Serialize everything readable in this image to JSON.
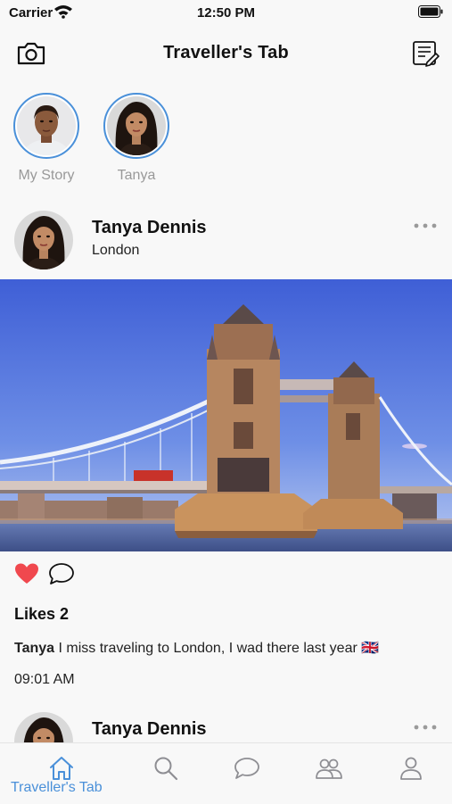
{
  "status_bar": {
    "carrier": "Carrier",
    "time": "12:50 PM"
  },
  "nav": {
    "title": "Traveller's Tab"
  },
  "stories": [
    {
      "label": "My Story"
    },
    {
      "label": "Tanya"
    }
  ],
  "posts": [
    {
      "name": "Tanya Dennis",
      "location": "London",
      "likes": "Likes 2",
      "caption_user": "Tanya",
      "caption_text": " I miss traveling to London, I wad there last year 🇬🇧",
      "time": "09:01 AM"
    },
    {
      "name": "Tanya Dennis"
    }
  ],
  "tab_bar": {
    "active_label": "Traveller's Tab"
  },
  "colors": {
    "accent": "#4a90d9",
    "heart": "#f0484e",
    "background": "#f8f8f8"
  },
  "icons": [
    "wifi-icon",
    "battery-icon",
    "camera-icon",
    "compose-icon",
    "more-icon",
    "heart-icon",
    "comment-icon",
    "home-icon",
    "search-icon",
    "chat-icon",
    "people-icon",
    "profile-icon"
  ]
}
